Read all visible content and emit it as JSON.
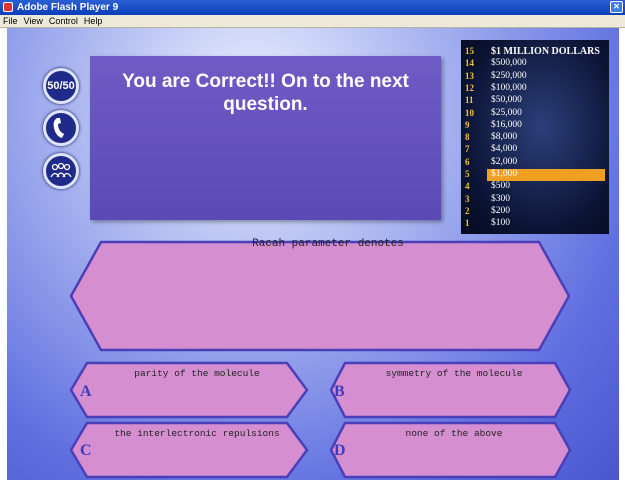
{
  "window": {
    "title": "Adobe Flash Player 9"
  },
  "menu": {
    "items": [
      "File",
      "View",
      "Control",
      "Help"
    ]
  },
  "lifelines": {
    "fifty_fifty": "50/50"
  },
  "message": {
    "text": "You are Correct!! On to the next question."
  },
  "money_ladder": [
    {
      "level": "15",
      "amount": "$1 MILLION DOLLARS"
    },
    {
      "level": "14",
      "amount": "$500,000"
    },
    {
      "level": "13",
      "amount": "$250,000"
    },
    {
      "level": "12",
      "amount": "$100,000"
    },
    {
      "level": "11",
      "amount": "$50,000"
    },
    {
      "level": "10",
      "amount": "$25,000"
    },
    {
      "level": "9",
      "amount": "$16,000"
    },
    {
      "level": "8",
      "amount": "$8,000"
    },
    {
      "level": "7",
      "amount": "$4,000"
    },
    {
      "level": "6",
      "amount": "$2,000"
    },
    {
      "level": "5",
      "amount": "$1,000",
      "current": true
    },
    {
      "level": "4",
      "amount": "$500"
    },
    {
      "level": "3",
      "amount": "$300"
    },
    {
      "level": "2",
      "amount": "$200"
    },
    {
      "level": "1",
      "amount": "$100"
    }
  ],
  "question": {
    "text": "Racah parameter denotes"
  },
  "answers": [
    {
      "letter": "A",
      "text": "parity of the molecule"
    },
    {
      "letter": "B",
      "text": "symmetry of the molecule"
    },
    {
      "letter": "C",
      "text": "the interlectronic repulsions"
    },
    {
      "letter": "D",
      "text": "none of the above"
    }
  ],
  "colors": {
    "panel_pink": "#d58fd0",
    "panel_border": "#4a3fb8",
    "highlight": "#f0a020",
    "message_box": "#6352bb"
  }
}
